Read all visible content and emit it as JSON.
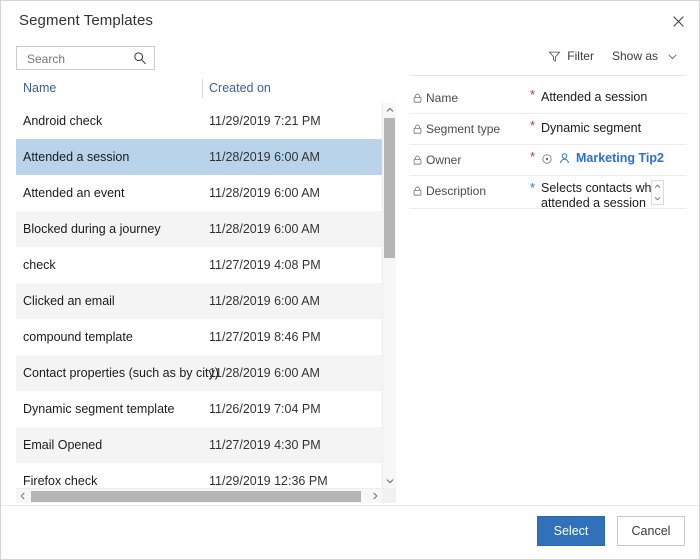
{
  "dialog": {
    "title": "Segment Templates",
    "close_label": "✕"
  },
  "toolbar": {
    "search_placeholder": "Search",
    "search_value": "",
    "filter_label": "Filter",
    "show_as_label": "Show as"
  },
  "list": {
    "columns": [
      {
        "label": "Name"
      },
      {
        "label": "Created on"
      }
    ],
    "rows": [
      {
        "name": "Android check",
        "created_on": "11/29/2019 7:21 PM",
        "selected": false
      },
      {
        "name": "Attended a session",
        "created_on": "11/28/2019 6:00 AM",
        "selected": true
      },
      {
        "name": "Attended an event",
        "created_on": "11/28/2019 6:00 AM",
        "selected": false
      },
      {
        "name": "Blocked during a journey",
        "created_on": "11/28/2019 6:00 AM",
        "selected": false
      },
      {
        "name": "check",
        "created_on": "11/27/2019 4:08 PM",
        "selected": false
      },
      {
        "name": "Clicked an email",
        "created_on": "11/28/2019 6:00 AM",
        "selected": false
      },
      {
        "name": "compound template",
        "created_on": "11/27/2019 8:46 PM",
        "selected": false
      },
      {
        "name": "Contact properties (such as by city)",
        "created_on": "11/28/2019 6:00 AM",
        "selected": false
      },
      {
        "name": "Dynamic segment template",
        "created_on": "11/26/2019 7:04 PM",
        "selected": false
      },
      {
        "name": "Email Opened",
        "created_on": "11/27/2019 4:30 PM",
        "selected": false
      },
      {
        "name": "Firefox check",
        "created_on": "11/29/2019 12:36 PM",
        "selected": false
      }
    ]
  },
  "detail": {
    "fields": [
      {
        "label": "Name",
        "required": true,
        "required_color": "#d13438",
        "value": "Attended a session",
        "type": "text"
      },
      {
        "label": "Segment type",
        "required": true,
        "required_color": "#d13438",
        "value": "Dynamic segment",
        "type": "text"
      },
      {
        "label": "Owner",
        "required": true,
        "required_color": "#d13438",
        "value": "Marketing Tip2",
        "type": "lookup"
      },
      {
        "label": "Description",
        "required": true,
        "required_color": "#2a6ed8",
        "value": "Selects contacts who attended a session",
        "type": "multiline"
      }
    ]
  },
  "footer": {
    "select_label": "Select",
    "cancel_label": "Cancel"
  },
  "colors": {
    "accent": "#3071b9",
    "selected_row": "#b8d3ea",
    "link": "#3b5ea5",
    "required_red": "#d13438",
    "required_blue": "#2a6ed8"
  }
}
